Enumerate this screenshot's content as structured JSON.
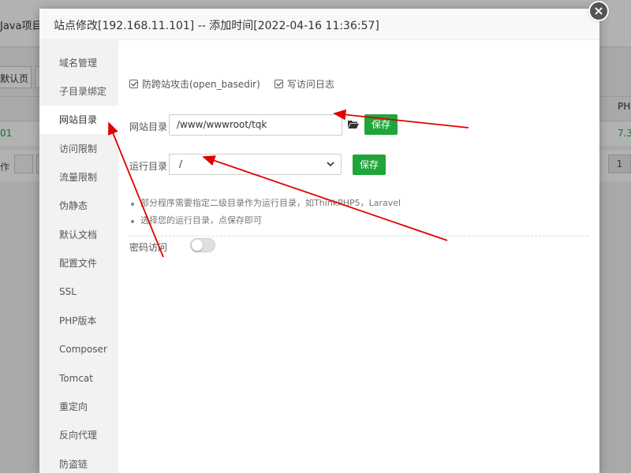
{
  "background": {
    "project_tab": "Java项目",
    "default_page_button": "默认页",
    "row_value": "01",
    "action_label": "作",
    "php_column_header": "PHP",
    "php_version": "7.3",
    "page_number": "1"
  },
  "modal": {
    "title": "站点修改[192.168.11.101] -- 添加时间[2022-04-16 11:36:57]",
    "close_glyph": "×"
  },
  "sidebar": {
    "items": [
      {
        "label": "域名管理"
      },
      {
        "label": "子目录绑定"
      },
      {
        "label": "网站目录"
      },
      {
        "label": "访问限制"
      },
      {
        "label": "流量限制"
      },
      {
        "label": "伪静态"
      },
      {
        "label": "默认文档"
      },
      {
        "label": "配置文件"
      },
      {
        "label": "SSL"
      },
      {
        "label": "PHP版本"
      },
      {
        "label": "Composer"
      },
      {
        "label": "Tomcat"
      },
      {
        "label": "重定向"
      },
      {
        "label": "反向代理"
      },
      {
        "label": "防盗链"
      }
    ],
    "active_index": 2
  },
  "settings": {
    "anti_xss_label": "防跨站攻击(open_basedir)",
    "anti_xss_checked": true,
    "access_log_label": "写访问日志",
    "access_log_checked": true,
    "site_dir_label": "网站目录",
    "site_dir_value": "/www/wwwroot/tqk",
    "save_label": "保存",
    "run_dir_label": "运行目录",
    "run_dir_value": "/",
    "run_dir_save_label": "保存",
    "tips": [
      "部分程序需要指定二级目录作为运行目录，如ThinkPHP5，Laravel",
      "选择您的运行目录，点保存即可"
    ],
    "password_access_label": "密码访问",
    "password_access_enabled": false
  },
  "colors": {
    "accent_green": "#20a53a",
    "annotation_red": "#e00000"
  }
}
